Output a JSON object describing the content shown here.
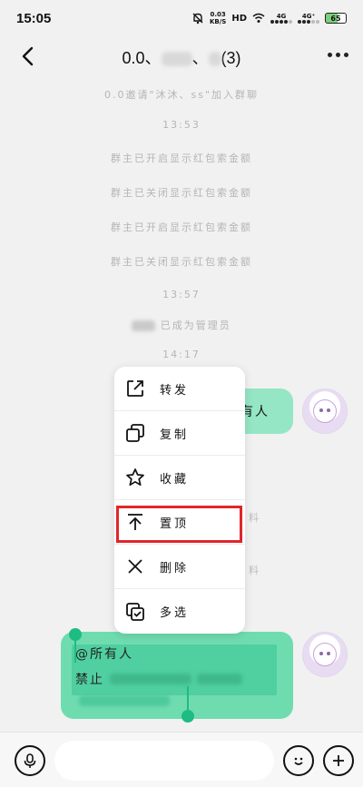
{
  "status_bar": {
    "time": "15:05",
    "net_speed_value": "0.03",
    "net_speed_unit": "KB/S",
    "hd_label": "HD",
    "signal1_label": "4G",
    "signal2_label": "4G⁺",
    "battery": "65"
  },
  "header": {
    "title_prefix": "0.0、",
    "title_sep": "、",
    "title_suffix": "(3)"
  },
  "system_messages": {
    "invite": "0.0邀请\"沐沐、ss\"加入群聊",
    "time1": "13:53",
    "msg1": "群主已开启显示红包索金额",
    "msg2": "群主已关闭显示红包索金额",
    "msg3": "群主已开启显示红包索金额",
    "msg4": "群主已关闭显示红包索金额",
    "time2": "13:57",
    "admin": "已成为管理员",
    "time3": "14:17"
  },
  "messages": {
    "bubble1_tail": "有人",
    "bubble2_fragment": "料",
    "bubble3_fragment": "料",
    "selected_line1": "@所有人",
    "selected_line2": "禁止"
  },
  "context_menu": {
    "items": [
      {
        "label": "转发",
        "icon": "share-icon"
      },
      {
        "label": "复制",
        "icon": "copy-icon"
      },
      {
        "label": "收藏",
        "icon": "star-icon"
      },
      {
        "label": "置顶",
        "icon": "pin-top-icon"
      },
      {
        "label": "删除",
        "icon": "close-icon"
      },
      {
        "label": "多选",
        "icon": "multi-select-icon"
      }
    ],
    "highlighted": "置顶"
  },
  "colors": {
    "bubble_green": "#95e6c4",
    "selection_green": "#6fdcb0",
    "highlight_red": "#e0262b",
    "handle_green": "#1ebc83"
  }
}
